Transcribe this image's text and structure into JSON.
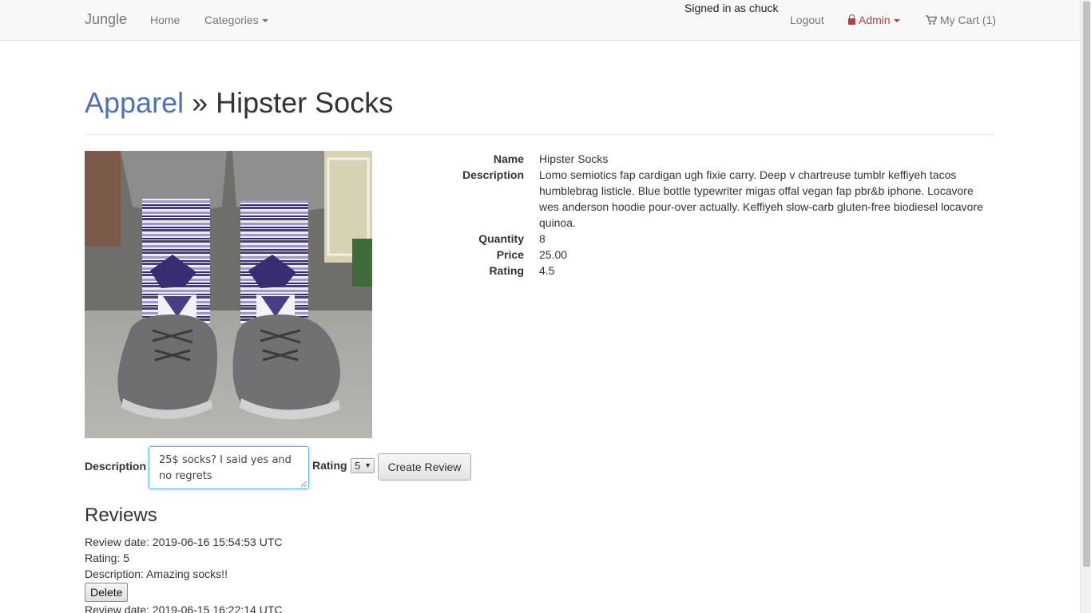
{
  "navbar": {
    "brand": "Jungle",
    "home": "Home",
    "categories": "Categories",
    "signed_in": "Signed in as chuck",
    "logout": "Logout",
    "admin": "Admin",
    "cart": "My Cart (1)"
  },
  "header": {
    "category": "Apparel",
    "separator": " » ",
    "product": "Hipster Socks"
  },
  "product": {
    "image_alt": "Hipster Socks",
    "details": [
      {
        "label": "Name",
        "value": "Hipster Socks"
      },
      {
        "label": "Description",
        "value": "Lomo semiotics fap cardigan ugh fixie carry. Deep v chartreuse tumblr keffiyeh tacos humblebrag listicle. Blue bottle typewriter migas offal vegan fap pbr&b iphone. Locavore wes anderson hoodie pour-over actually. Keffiyeh slow-carb gluten-free biodiesel locavore quinoa."
      },
      {
        "label": "Quantity",
        "value": "8"
      },
      {
        "label": "Price",
        "value": "25.00"
      },
      {
        "label": "Rating",
        "value": "4.5"
      }
    ]
  },
  "review_form": {
    "description_label": "Description",
    "description_value": "25$ socks? I said yes and no regrets",
    "rating_label": "Rating",
    "rating_value": "5",
    "submit": "Create Review"
  },
  "reviews": {
    "title": "Reviews",
    "items": [
      {
        "date": "Review date: 2019-06-16 15:54:53 UTC",
        "rating": "Rating: 5",
        "description": "Description: Amazing socks!!",
        "delete": "Delete"
      },
      {
        "date": "Review date: 2019-06-15 16:22:14 UTC"
      }
    ]
  },
  "colors": {
    "link": "#4f6fbf",
    "admin": "#a94442",
    "focus": "#66afe9"
  }
}
